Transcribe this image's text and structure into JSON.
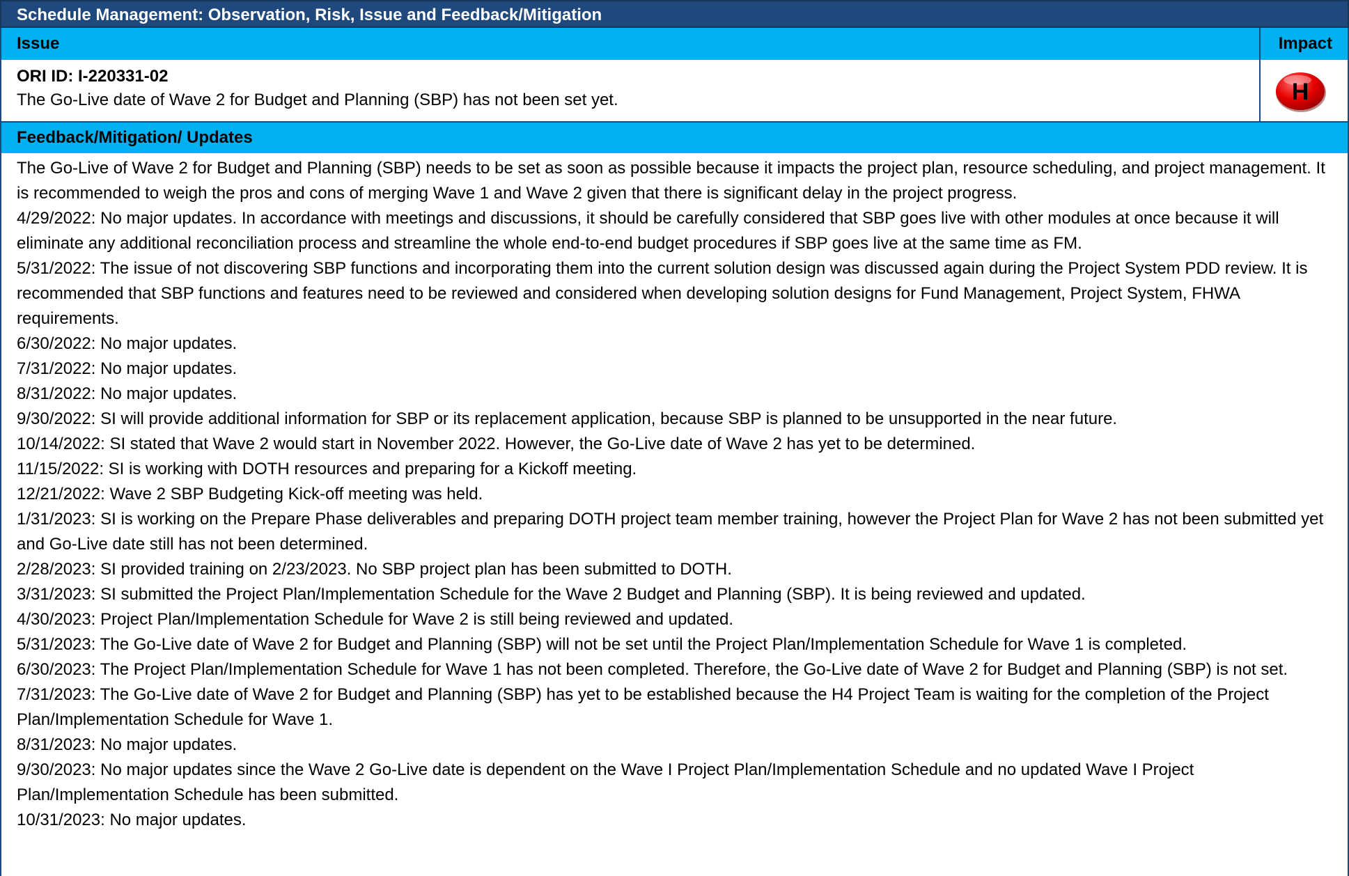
{
  "title": "Schedule Management: Observation, Risk, Issue and Feedback/Mitigation",
  "headers": {
    "issue": "Issue",
    "impact": "Impact"
  },
  "issue": {
    "ori_id": "ORI ID: I-220331-02",
    "description": "The Go-Live date of Wave 2 for Budget and Planning (SBP) has not been set yet.",
    "impact_badge": "H",
    "impact_color": "#e60000"
  },
  "feedback": {
    "header": "Feedback/Mitigation/ Updates",
    "paragraphs": [
      "The Go-Live of Wave 2 for Budget and Planning (SBP) needs to be set as soon as possible because it impacts the project plan, resource scheduling, and project management. It is recommended to weigh the pros and cons of merging Wave 1 and Wave 2 given that there is significant delay in the project progress.",
      "4/29/2022: No major updates. In accordance with meetings and discussions, it should be carefully considered that SBP goes live with other modules at once because it will eliminate any additional reconciliation process and streamline the whole end-to-end budget procedures if SBP goes live at the same time as FM.",
      "5/31/2022: The issue of not discovering SBP functions and incorporating them into the current solution design was discussed again during the Project System PDD review. It is recommended that SBP functions and features need to be reviewed and considered when developing solution designs for Fund Management, Project System, FHWA requirements.",
      "6/30/2022: No major updates.",
      "7/31/2022: No major updates.",
      "8/31/2022: No major updates.",
      "9/30/2022: SI will provide additional information for SBP or its replacement application, because SBP is planned to be unsupported in the near future.",
      "10/14/2022: SI stated that Wave 2 would start in November 2022. However, the Go-Live date of Wave 2 has yet to be determined.",
      "11/15/2022: SI is working with DOTH resources and preparing for a Kickoff meeting.",
      "12/21/2022: Wave 2 SBP Budgeting Kick-off meeting was held.",
      "1/31/2023: SI is working on the Prepare Phase deliverables and preparing DOTH project team member training, however the Project Plan for Wave 2 has not been submitted yet and Go-Live date still has not been determined.",
      "2/28/2023: SI provided training on 2/23/2023. No SBP project plan has been submitted to DOTH.",
      "3/31/2023: SI submitted the Project Plan/Implementation Schedule for the Wave 2 Budget and Planning (SBP). It is being reviewed and updated.",
      "4/30/2023: Project Plan/Implementation Schedule for Wave 2 is still being reviewed and updated.",
      "5/31/2023: The Go-Live date of Wave 2 for Budget and Planning (SBP) will not be set until the Project Plan/Implementation Schedule for Wave 1 is completed.",
      "6/30/2023: The Project Plan/Implementation Schedule for Wave 1 has not been completed. Therefore, the Go-Live date of Wave 2 for Budget and Planning (SBP) is not set.",
      "7/31/2023: The Go-Live date of Wave 2 for Budget and Planning (SBP) has yet to be established because the H4 Project Team is waiting for the completion of the Project Plan/Implementation Schedule for Wave 1.",
      "8/31/2023: No major updates.",
      "9/30/2023: No major updates since the Wave 2 Go-Live date is dependent on the Wave I Project Plan/Implementation Schedule and no updated Wave I Project Plan/Implementation Schedule has been submitted.",
      "10/31/2023: No major updates."
    ]
  }
}
